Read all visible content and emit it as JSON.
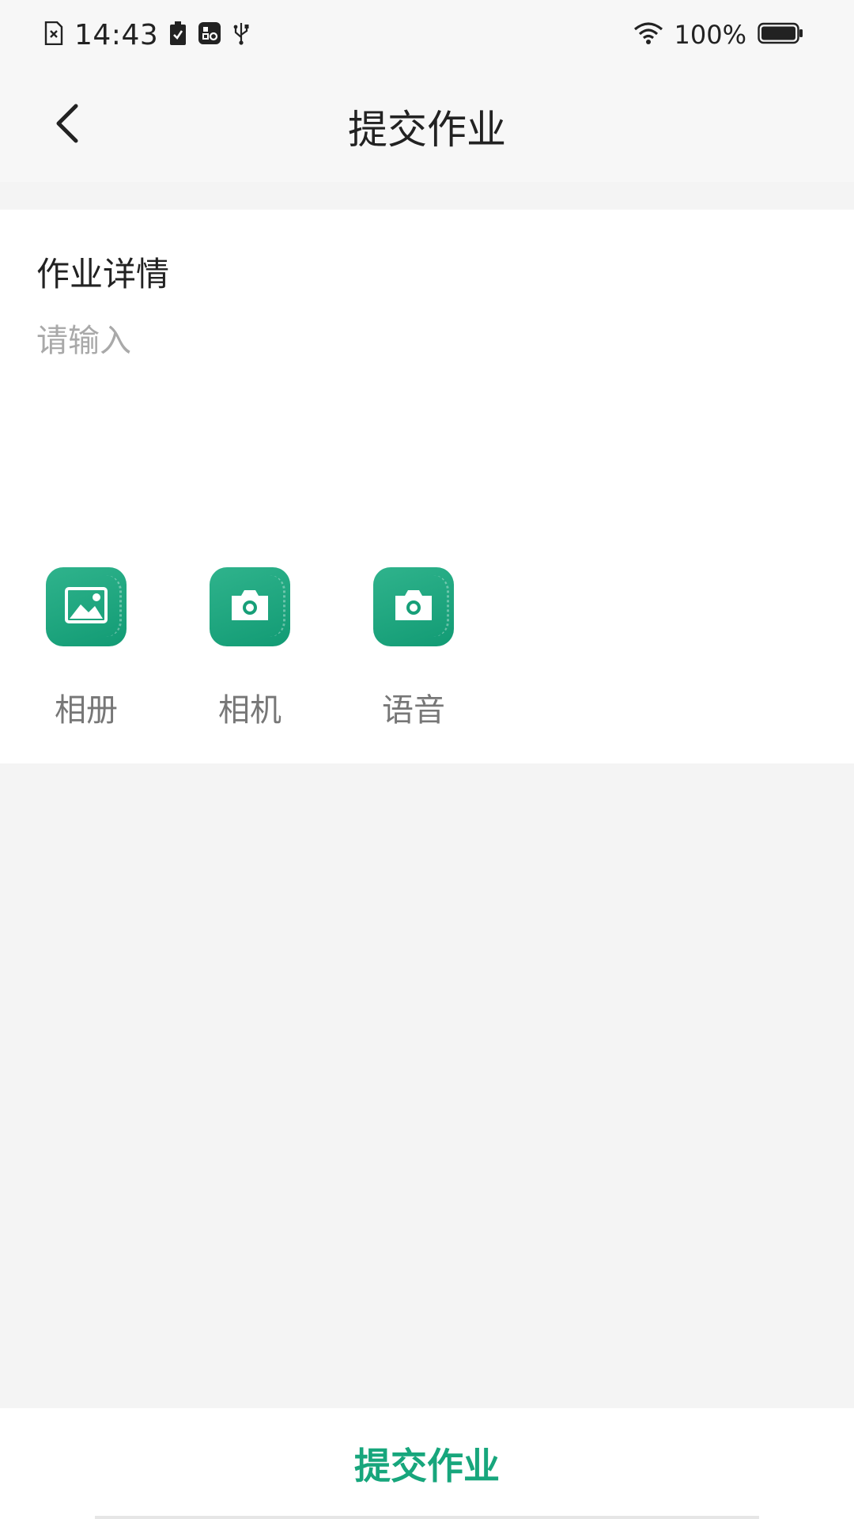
{
  "status_bar": {
    "time": "14:43",
    "battery_percent": "100%",
    "icons_left": [
      "sim-off-icon",
      "battery-saver-icon",
      "app-notification-icon",
      "usb-icon"
    ],
    "icons_right": [
      "wifi-icon",
      "battery-icon"
    ]
  },
  "header": {
    "title": "提交作业",
    "back_icon": "chevron-left-icon"
  },
  "form": {
    "section_title": "作业详情",
    "detail_input": {
      "value": "",
      "placeholder": "请输入"
    },
    "attachments": [
      {
        "label": "相册",
        "icon": "album-icon"
      },
      {
        "label": "相机",
        "icon": "camera-icon"
      },
      {
        "label": "语音",
        "icon": "camera-icon"
      }
    ]
  },
  "footer": {
    "submit_label": "提交作业"
  },
  "colors": {
    "accent": "#17a67c",
    "tile_gradient_start": "#2fb38c",
    "tile_gradient_end": "#129b74",
    "page_background": "#f4f4f4",
    "placeholder": "#a9a9a9"
  }
}
